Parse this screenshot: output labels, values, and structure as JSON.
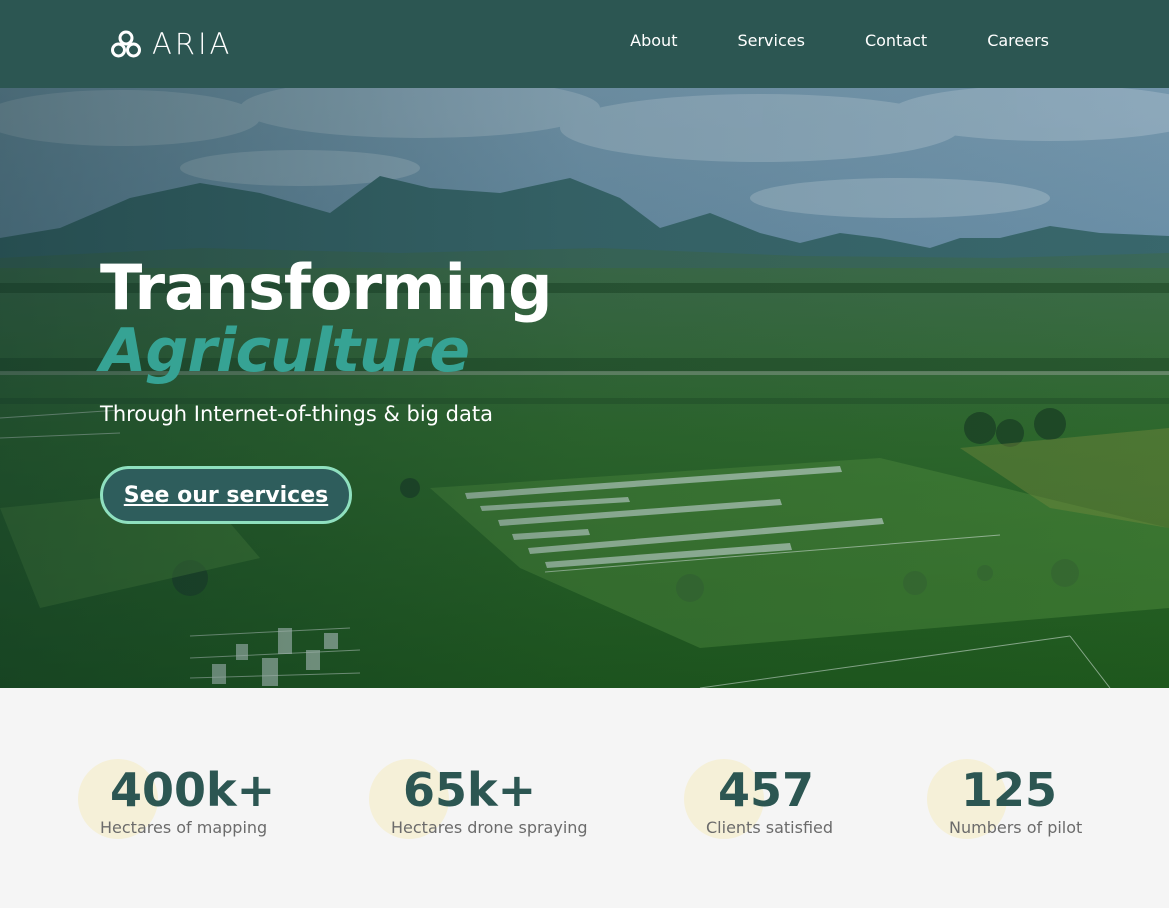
{
  "brand": {
    "name": "ARIA"
  },
  "nav": {
    "items": [
      {
        "label": "About"
      },
      {
        "label": "Services"
      },
      {
        "label": "Contact"
      },
      {
        "label": "Careers"
      }
    ]
  },
  "hero": {
    "title_line1": "Transforming",
    "title_line2": "Agriculture",
    "subtitle": "Through Internet-of-things & big data",
    "cta_label": "See our services"
  },
  "stats": [
    {
      "value": "400k+",
      "label": "Hectares of mapping"
    },
    {
      "value": "65k+",
      "label": "Hectares drone spraying"
    },
    {
      "value": "457",
      "label": "Clients satisfied"
    },
    {
      "value": "125",
      "label": "Numbers of pilot"
    }
  ],
  "colors": {
    "nav_bg": "#2c5652",
    "accent": "#36a394",
    "cta_border": "#8fe0bf",
    "stat_number": "#2c5652"
  }
}
